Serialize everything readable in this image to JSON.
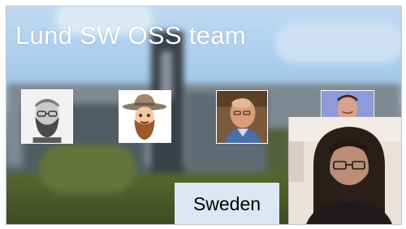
{
  "slide": {
    "title": "Lund SW OSS team",
    "country": "Sweden"
  },
  "participants": [
    {
      "name": "member-1-photo",
      "icon": "bearded-glasses-man-icon"
    },
    {
      "name": "member-2-avatar",
      "icon": "cartoon-cowboy-hat-icon"
    },
    {
      "name": "member-3-photo",
      "icon": "bald-man-icon"
    },
    {
      "name": "member-4-photo",
      "icon": "smiling-man-icon"
    }
  ],
  "colors": {
    "sky": "#a9cdee",
    "label_bg": "#dde7f3",
    "title_text": "#ffffff"
  }
}
